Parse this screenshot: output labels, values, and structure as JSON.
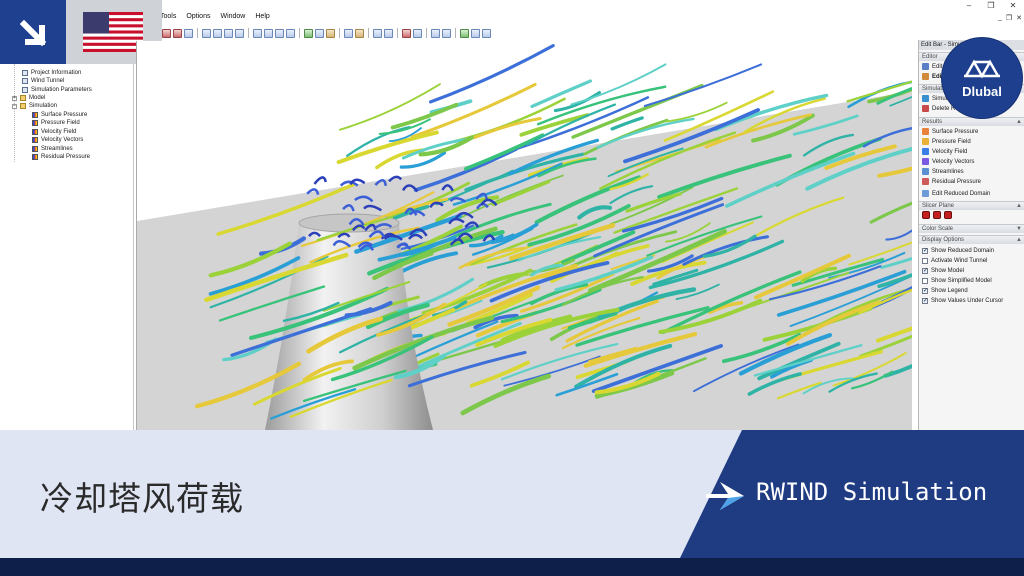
{
  "window": {
    "controls": [
      "–",
      "❐",
      "✕"
    ],
    "mdi_controls": [
      "_",
      "❐",
      "✕"
    ]
  },
  "menu": {
    "items": [
      "Tools",
      "Options",
      "Window",
      "Help"
    ]
  },
  "navigator": {
    "items": [
      {
        "label": "Project Information",
        "icon": "info-icon",
        "indent": 2
      },
      {
        "label": "Wind Tunnel",
        "icon": "wind-tunnel-icon",
        "indent": 2
      },
      {
        "label": "Simulation Parameters",
        "icon": "parameters-icon",
        "indent": 2
      },
      {
        "label": "Model",
        "icon": "folder-icon",
        "indent": 1
      },
      {
        "label": "Simulation",
        "icon": "folder-icon",
        "indent": 1
      },
      {
        "label": "Surface Pressure",
        "icon": "result-icon",
        "indent": 3
      },
      {
        "label": "Pressure Field",
        "icon": "result-icon",
        "indent": 3
      },
      {
        "label": "Velocity Field",
        "icon": "result-icon",
        "indent": 3
      },
      {
        "label": "Velocity Vectors",
        "icon": "result-icon",
        "indent": 3
      },
      {
        "label": "Streamlines",
        "icon": "result-icon",
        "indent": 3
      },
      {
        "label": "Residual Pressure",
        "icon": "result-icon",
        "indent": 3
      }
    ]
  },
  "editbar": {
    "title": "Edit Bar - Simul",
    "sections": {
      "editor": "Editor",
      "simulation": "Simulation",
      "results": "Results",
      "slicer": "Slicer Plane",
      "color_scale": "Color Scale",
      "display": "Display Options"
    },
    "editor_items": [
      "Edit M",
      "Edit"
    ],
    "simulation_items": [
      "Simulati",
      "Delete Re"
    ],
    "results_items": [
      {
        "label": "Surface Pressure",
        "color": "#e8823a"
      },
      {
        "label": "Pressure Field",
        "color": "#e8b23a"
      },
      {
        "label": "Velocity Field",
        "color": "#3a7fe8"
      },
      {
        "label": "Velocity Vectors",
        "color": "#7a5ae0"
      },
      {
        "label": "Streamlines",
        "color": "#5a8fd0"
      },
      {
        "label": "Residual Pressure",
        "color": "#d05a5a"
      }
    ],
    "edit_reduced_domain": "Edit Reduced Domain",
    "display_options": [
      {
        "label": "Show Reduced Domain",
        "checked": true
      },
      {
        "label": "Activate Wind Tunnel",
        "checked": false
      },
      {
        "label": "Show Model",
        "checked": true
      },
      {
        "label": "Show Simplified Model",
        "checked": false
      },
      {
        "label": "Show Legend",
        "checked": true
      },
      {
        "label": "Show Values Under Cursor",
        "checked": true
      }
    ]
  },
  "brand": {
    "logo_text": "Dlubal",
    "logo_color": "#1d3f8e"
  },
  "banner": {
    "title_cn": "冷却塔风荷载",
    "product": "RWIND Simulation",
    "light_color": "#dfe5f3",
    "dark_color": "#1f3c82"
  }
}
